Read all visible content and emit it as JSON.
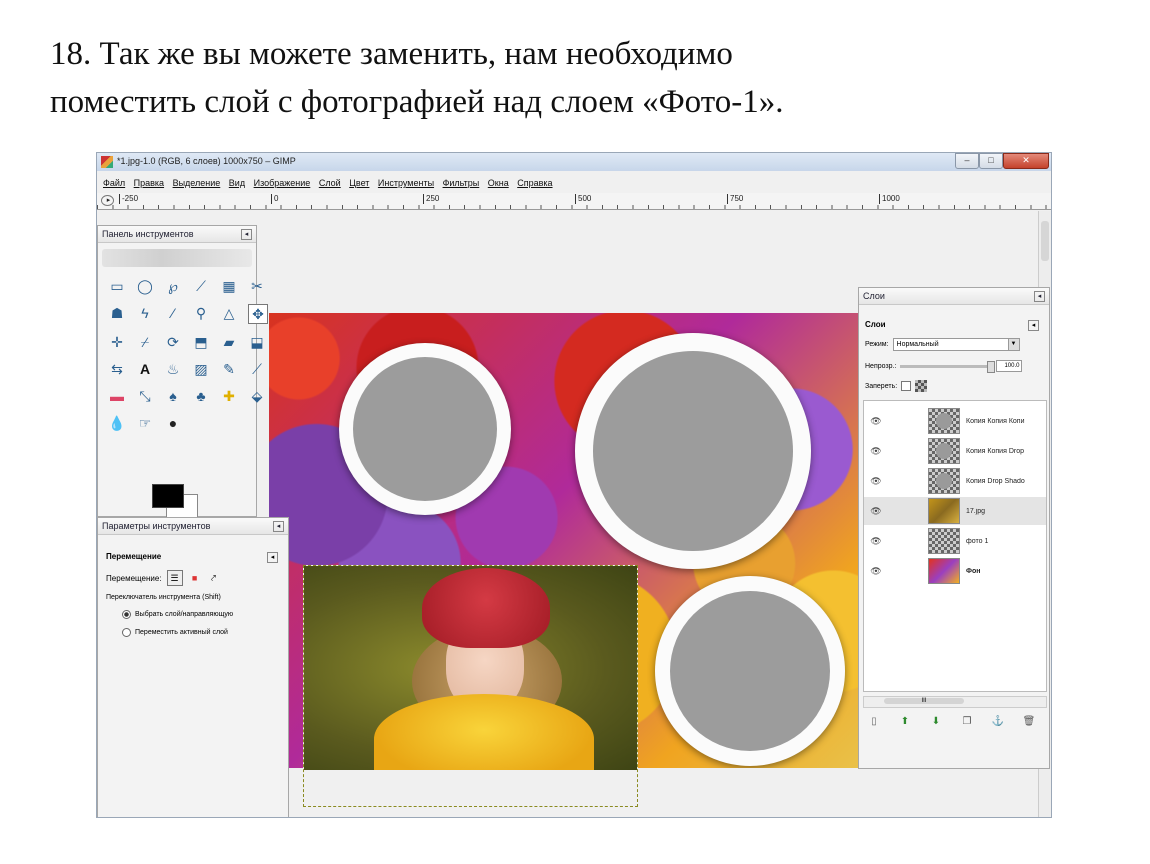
{
  "caption": {
    "line1": "18. Так же вы можете заменить, нам необходимо",
    "line2": "поместить слой с фотографией над слоем «Фото-1»."
  },
  "window": {
    "title": "*1.jpg-1.0 (RGB, 6 слоев) 1000x750 – GIMP",
    "buttons": {
      "minimize": "–",
      "maximize": "□",
      "close": "✕"
    }
  },
  "menu": [
    "Файл",
    "Правка",
    "Выделение",
    "Вид",
    "Изображение",
    "Слой",
    "Цвет",
    "Инструменты",
    "Фильтры",
    "Окна",
    "Справка"
  ],
  "ruler": {
    "ticks": [
      "-250",
      "0",
      "250",
      "500",
      "750",
      "1000"
    ]
  },
  "toolbox": {
    "title": "Панель инструментов",
    "icons": [
      "rect-select-icon",
      "ellipse-select-icon",
      "lasso-icon",
      "fuzzy-select-icon",
      "color-select-icon",
      "scissors-icon",
      "foreground-select-icon",
      "paths-icon",
      "color-picker-icon",
      "zoom-icon",
      "measure-icon",
      "move-icon",
      "align-icon",
      "crop-icon",
      "rotate-icon",
      "scale-icon",
      "shear-icon",
      "perspective-icon",
      "flip-icon",
      "text-icon",
      "bucket-fill-icon",
      "blend-icon",
      "pencil-icon",
      "paintbrush-icon",
      "eraser-icon",
      "airbrush-icon",
      "ink-icon",
      "clone-icon",
      "heal-icon",
      "perspective-clone-icon",
      "blur-icon",
      "smudge-icon",
      "dodge-icon"
    ],
    "foreground_color": "#000000",
    "background_color": "#ffffff"
  },
  "tool_options": {
    "title": "Параметры инструментов",
    "tool_name": "Перемещение",
    "move_label": "Перемещение:",
    "toggle_label": "Переключатель инструмента (Shift)",
    "radio1": "Выбрать слой/направляющую",
    "radio2": "Переместить активный слой"
  },
  "layers": {
    "title": "Слои",
    "section": "Слои",
    "mode_label": "Режим:",
    "mode_value": "Нормальный",
    "opacity_label": "Непрозр.:",
    "opacity_value": "100.0",
    "lock_label": "Запереть:",
    "items": [
      {
        "name": "Копия Копия Копи",
        "thumb": "circle",
        "selected": false
      },
      {
        "name": "Копия Копия Drop",
        "thumb": "circle",
        "selected": false
      },
      {
        "name": "Копия Drop Shado",
        "thumb": "circle",
        "selected": false
      },
      {
        "name": "17.jpg",
        "thumb": "image",
        "selected": true
      },
      {
        "name": "фото 1",
        "thumb": "circle",
        "selected": false
      },
      {
        "name": "Фон",
        "thumb": "background",
        "selected": false
      }
    ],
    "scroll_label": "III",
    "buttons": [
      "new-layer-icon",
      "raise-layer-icon",
      "lower-layer-icon",
      "duplicate-layer-icon",
      "anchor-layer-icon",
      "delete-layer-icon"
    ]
  }
}
